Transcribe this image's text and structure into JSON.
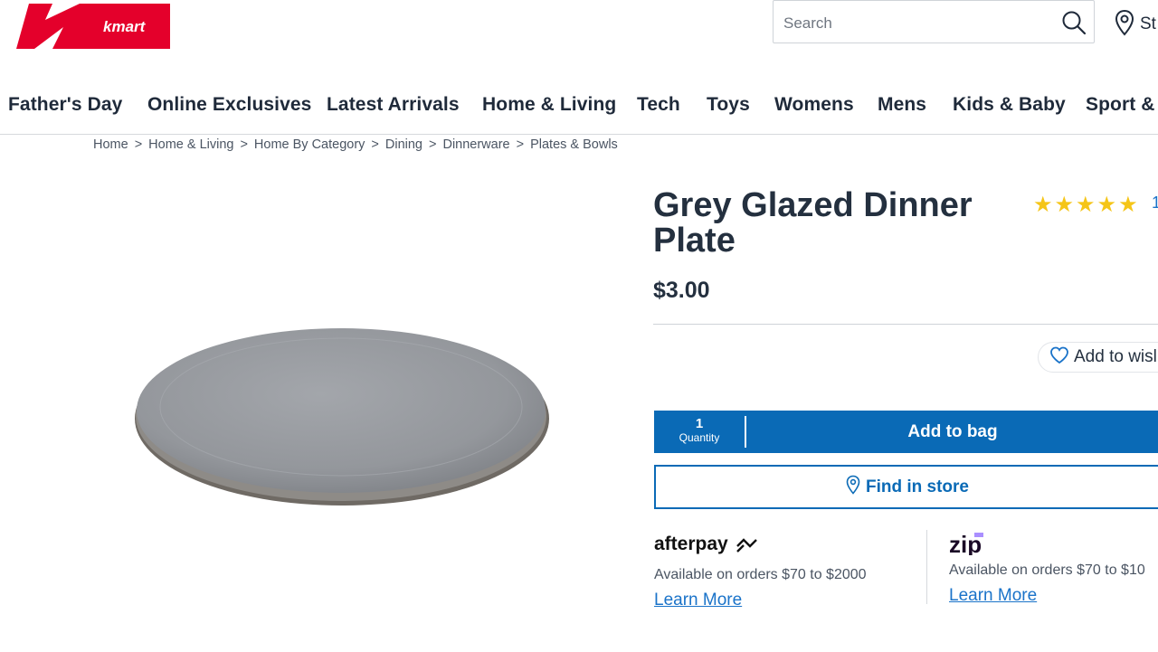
{
  "header": {
    "logo_text": "kmart",
    "search_placeholder": "Search",
    "store_label": "St"
  },
  "nav": {
    "items": [
      "Father's Day",
      "Online Exclusives",
      "Latest Arrivals",
      "Home & Living",
      "Tech",
      "Toys",
      "Womens",
      "Mens",
      "Kids & Baby",
      "Sport &"
    ]
  },
  "breadcrumb": [
    "Home",
    "Home & Living",
    "Home By Category",
    "Dining",
    "Dinnerware",
    "Plates & Bowls"
  ],
  "product": {
    "title": "Grey Glazed Dinner Plate",
    "rating_stars": "★★★★★",
    "rating_value": 5,
    "review_count": "1",
    "price": "$3.00",
    "wishlist_label": "Add to wisl",
    "quantity_value": "1",
    "quantity_label": "Quantity",
    "add_to_bag_label": "Add to bag",
    "find_in_store_label": "Find in store"
  },
  "payment": {
    "afterpay": {
      "logo_text": "afterpay",
      "text": "Available on orders $70 to $2000",
      "link": "Learn More"
    },
    "zip": {
      "logo_text": "zip",
      "text": "Available on orders $70 to $10",
      "link": "Learn More"
    }
  },
  "colors": {
    "brand_red": "#e4002b",
    "action_blue": "#0a6ab6",
    "link_blue": "#1a73c9",
    "star_yellow": "#f5c518",
    "zip_purple": "#aa8fff"
  }
}
